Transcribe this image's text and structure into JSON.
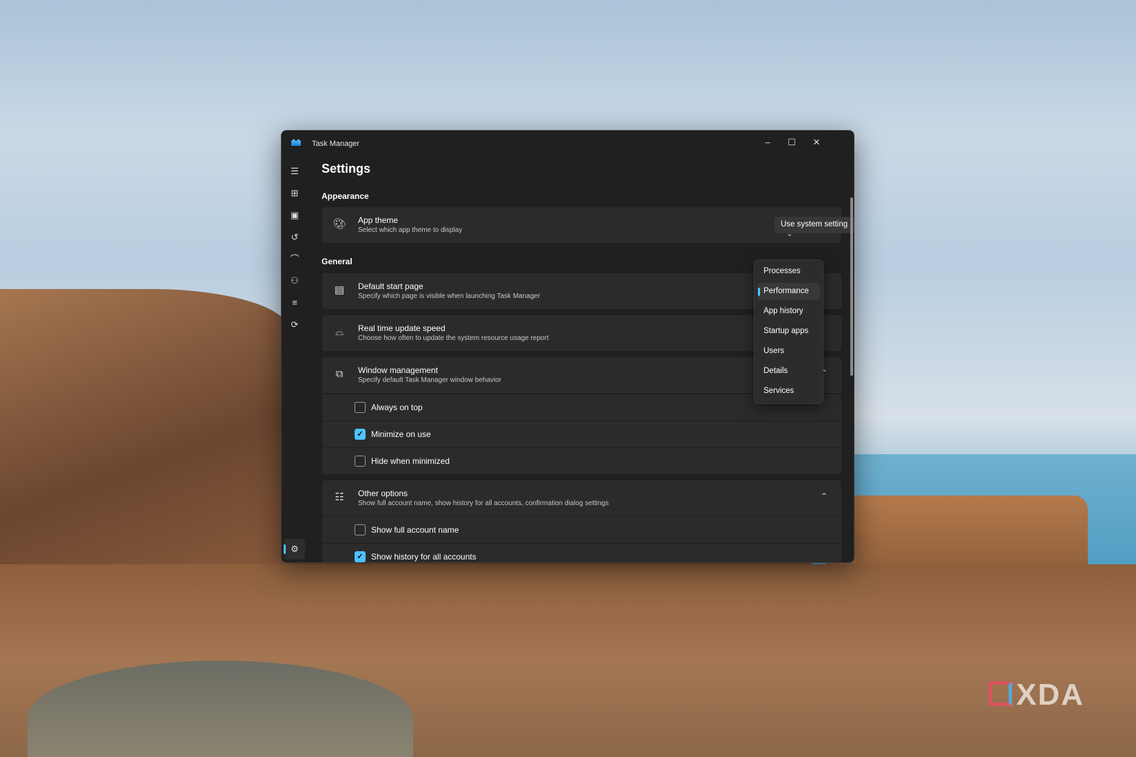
{
  "window": {
    "title": "Task Manager",
    "minimize": "–",
    "maximize": "☐",
    "close": "✕"
  },
  "sidebar": {
    "items": [
      {
        "icon": "hamburger-icon",
        "glyph": "☰"
      },
      {
        "icon": "processes-icon",
        "glyph": "⊞"
      },
      {
        "icon": "performance-icon",
        "glyph": "▣"
      },
      {
        "icon": "app-history-icon",
        "glyph": "↺"
      },
      {
        "icon": "startup-icon",
        "glyph": "⌒"
      },
      {
        "icon": "users-icon",
        "glyph": "⚇"
      },
      {
        "icon": "details-icon",
        "glyph": "≡"
      },
      {
        "icon": "services-icon",
        "glyph": "⟳"
      }
    ],
    "settings_glyph": "⚙"
  },
  "page": {
    "title": "Settings",
    "appearance": "Appearance",
    "general": "General"
  },
  "app_theme": {
    "label": "App theme",
    "desc": "Select which app theme to display",
    "value": "Use system setting",
    "chevron": "⌄"
  },
  "default_start": {
    "label": "Default start page",
    "desc": "Specify which page is visible when launching Task Manager"
  },
  "update_speed": {
    "label": "Real time update speed",
    "desc": "Choose how often to update the system resource usage report"
  },
  "window_mgmt": {
    "label": "Window management",
    "desc": "Specify default Task Manager window behavior",
    "options": [
      {
        "label": "Always on top",
        "checked": false
      },
      {
        "label": "Minimize on use",
        "checked": true
      },
      {
        "label": "Hide when minimized",
        "checked": false
      }
    ]
  },
  "other": {
    "label": "Other options",
    "desc": "Show full account name, show history for all accounts, confirmation dialog settings",
    "options": [
      {
        "label": "Show full account name",
        "checked": false
      },
      {
        "label": "Show history for all accounts",
        "checked": true
      }
    ]
  },
  "menu": {
    "items": [
      "Processes",
      "Performance",
      "App history",
      "Startup apps",
      "Users",
      "Details",
      "Services"
    ],
    "selected": "Performance"
  },
  "glyphs": {
    "check": "✓",
    "collapse": "⌃"
  },
  "watermark": "XDA",
  "colors": {
    "accent": "#4cc2ff",
    "bg": "#202020",
    "card": "#2b2b2b"
  }
}
